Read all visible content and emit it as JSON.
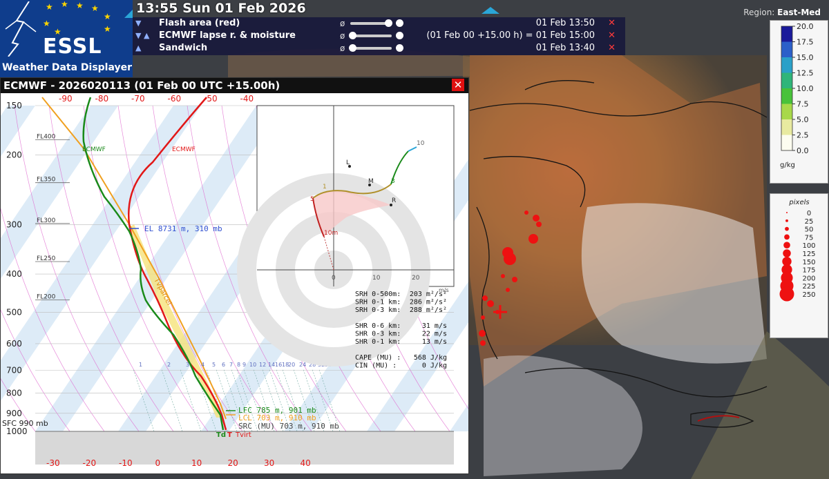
{
  "header": {
    "datetime": "13:55 Sun 01 Feb 2026",
    "region_label": "Region:",
    "region_value": "East-Med"
  },
  "logo": {
    "name": "ESSL",
    "subtitle": "Weather Data Displayer"
  },
  "layers": [
    {
      "arrows": "▼",
      "name": "Flash area (red)",
      "phi": "ø",
      "time": "01 Feb 13:50",
      "close": "✕"
    },
    {
      "arrows": "▼ ▲",
      "name": "ECMWF lapse r. & moisture",
      "phi": "ø",
      "time": "(01 Feb 00 +15.00 h) = 01 Feb 15:00",
      "close": "✕"
    },
    {
      "arrows": "▲",
      "name": "Sandwich",
      "phi": "ø",
      "time": "01 Feb 13:40",
      "close": "✕"
    }
  ],
  "sounding": {
    "title": "ECMWF - 2026020113 (01 Feb 00 UTC +15.00h)",
    "close": "✕",
    "pressure_ticks": [
      "150",
      "200",
      "300",
      "400",
      "500",
      "600",
      "700",
      "800",
      "900",
      "1000"
    ],
    "top_temp_ticks": [
      "-90",
      "-80",
      "-70",
      "-60",
      "-50",
      "-40"
    ],
    "bottom_temp_ticks": [
      "-30",
      "-20",
      "-10",
      "0",
      "10",
      "20",
      "30",
      "40"
    ],
    "fl_labels": [
      "FL400",
      "FL350",
      "FL300",
      "FL250",
      "FL200"
    ],
    "mixing_ratio_labels": [
      "1",
      "2",
      "3",
      "4",
      "5",
      "6",
      "7",
      "8",
      "9",
      "10",
      "12",
      "14",
      "16",
      "18",
      "20",
      "24",
      "28",
      "32",
      "36"
    ],
    "series_labels": {
      "td": "ECMWF",
      "t": "ECMWF",
      "parcel": "Tvparcel",
      "td_bottom": "Td",
      "t_bottom": "T",
      "tvirt_bottom": "Tvirt"
    },
    "el_label": "EL 8731 m, 310 mb",
    "lfc_label": "LFC 785 m, 901 mb",
    "lcl_label": "LCL 703 m, 910 mb",
    "src_label": "SRC (MU) 703 m, 910 mb",
    "sfc_label": "SFC 990 mb",
    "hodograph": {
      "ticks": [
        "0",
        "10",
        "20"
      ],
      "unit": "m/s",
      "points": {
        "L": "L",
        "M": "M",
        "R": "R",
        "h10m": "10m",
        "h1": "1",
        "h3": "3",
        "h5": "5",
        "h10": "10"
      }
    },
    "params": [
      {
        "label": "SRH 0-500m:",
        "value": "203 m²/s²"
      },
      {
        "label": "SRH 0-1 km:",
        "value": "286 m²/s²"
      },
      {
        "label": "SRH 0-3 km:",
        "value": "288 m²/s²"
      },
      {
        "label": "",
        "value": ""
      },
      {
        "label": "SHR 0-6 km:",
        "value": "31 m/s"
      },
      {
        "label": "SHR 0-3 km:",
        "value": "22 m/s"
      },
      {
        "label": "SHR 0-1 km:",
        "value": "13 m/s"
      },
      {
        "label": "",
        "value": ""
      },
      {
        "label": "CAPE (MU) :",
        "value": "568 J/kg"
      },
      {
        "label": "CIN  (MU) :",
        "value": "0 J/kg"
      }
    ]
  },
  "colorbar": {
    "ticks": [
      "20.0",
      "17.5",
      "15.0",
      "12.5",
      "10.0",
      "7.5",
      "5.0",
      "2.5",
      "0.0"
    ],
    "unit": "g/kg",
    "colors": [
      "#1a1a9a",
      "#2b5fc9",
      "#2aa0c8",
      "#2fb57a",
      "#48c23a",
      "#a8d84a",
      "#e8eaa0",
      "#fdfdf0"
    ]
  },
  "pixels_legend": {
    "title": "pixels",
    "values": [
      "0",
      "25",
      "50",
      "75",
      "100",
      "125",
      "150",
      "175",
      "200",
      "225",
      "250"
    ],
    "color": "#ee1111"
  }
}
